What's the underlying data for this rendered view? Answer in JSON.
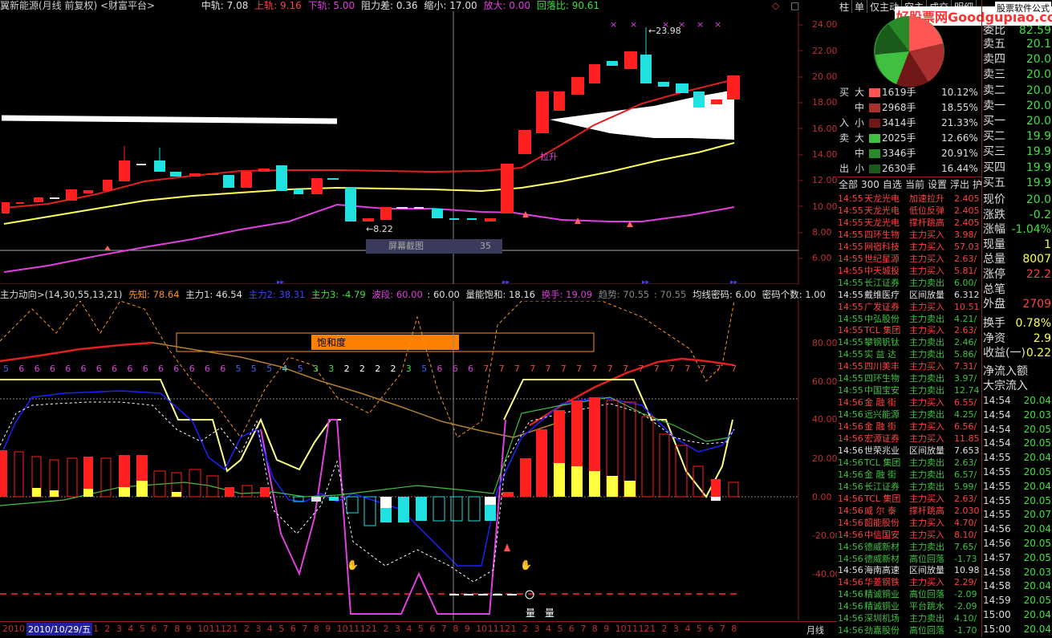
{
  "main_header": {
    "title": "翼新能源(月线 前复权) <财富平台>",
    "mid_label": "中轨: 7.08",
    "up_label": "上轨: 9.16",
    "down_label": "下轨: 5.00",
    "resist_label": "阻力差: 0.36",
    "shrink_label": "缩小: 17.00",
    "enlarge_label": "放大: 0.00",
    "pullback_label": "回落比: 90.61"
  },
  "price_axis": [
    "24.00",
    "22.00",
    "20.00",
    "18.00",
    "16.00",
    "14.00",
    "12.00",
    "10.00",
    "8.00",
    "6.00"
  ],
  "annotations": {
    "high": "23.98",
    "low": "8.22",
    "screen_capture": "屏幕截图",
    "screen_capture_num": "35",
    "right_arrow_label": "拉升",
    "saturation": "饱和度"
  },
  "indicator_header": {
    "name": "主力动向>(14,30,55,13,21)",
    "xianzhi": "先知: 78.64",
    "zhuli1": "主力1: 46.54",
    "zhuli2": "主力2: 38.31",
    "zhuli3": "主力3: -4.79",
    "boduan": "波段: 60.00",
    "boduan2": ": 60.00",
    "liangneng": "量能饱和: 18.16",
    "huanshou": "换手: 19.09",
    "qushi": "趋势: 70.55",
    "qushi2": ": 70.55",
    "junxian": "均线密码: 6.00",
    "mima": "密码个数: 1.00"
  },
  "indicator_axis": [
    "80.00",
    "60.00",
    "40.00",
    "20.00",
    "0.00",
    "-20.00",
    "-40.00"
  ],
  "digit_strip": [
    "5",
    "6",
    "6",
    "6",
    "6",
    "6",
    "6",
    "6",
    "6",
    "6",
    "6",
    "6",
    "6",
    "6",
    "6",
    "5",
    "5",
    "5",
    "4",
    "5",
    "3",
    "3",
    "2",
    "2",
    "2",
    "2",
    "3",
    "5",
    "6",
    "6",
    "6",
    "7",
    "7",
    "7",
    "7",
    "7",
    "7",
    "7",
    "7",
    "7",
    "7",
    "7",
    "7",
    "7",
    "7",
    "7",
    "7",
    "7"
  ],
  "date_bar": {
    "year_stub": "2010",
    "selected_date": "2010/10/29/五",
    "numbers": [
      "1",
      "2",
      "3",
      "4",
      "5",
      "6",
      "7",
      "8",
      "9",
      "10",
      "11",
      "12",
      "1",
      "2",
      "3",
      "4",
      "5",
      "6",
      "7",
      "8",
      "9",
      "10",
      "11",
      "12",
      "1",
      "2",
      "3",
      "4",
      "5",
      "6",
      "7",
      "8",
      "9",
      "10",
      "11",
      "12",
      "1",
      "2",
      "3",
      "4",
      "5",
      "6",
      "7",
      "8",
      "9",
      "10",
      "11",
      "12",
      "1",
      "2",
      "3",
      "4",
      "5",
      "6",
      "7",
      "8"
    ],
    "period": "月线",
    "vol_labels": [
      "量",
      "量"
    ]
  },
  "right_panel": {
    "tabs_top": [
      "柱",
      "单",
      "仅主动",
      "空主",
      "成交",
      "明细"
    ],
    "watermark": "好股票网Goodgupiao.com",
    "watermark2": "股票软件公式",
    "buy_rows": [
      {
        "side": "买",
        "cls": "大",
        "vol": "1619手",
        "pct": "10.12%",
        "color": "#ff5555"
      },
      {
        "side": "",
        "cls": "中",
        "vol": "2968手",
        "pct": "18.55%",
        "color": "#aa3030"
      },
      {
        "side": "入",
        "cls": "小",
        "vol": "3414手",
        "pct": "21.33%",
        "color": "#701818"
      }
    ],
    "sell_rows": [
      {
        "side": "卖",
        "cls": "大",
        "vol": "2025手",
        "pct": "12.66%",
        "color": "#40c040"
      },
      {
        "side": "",
        "cls": "中",
        "vol": "3346手",
        "pct": "20.91%",
        "color": "#2a8a2a"
      },
      {
        "side": "出",
        "cls": "小",
        "vol": "2630手",
        "pct": "16.44%",
        "color": "#1a5a1a"
      }
    ],
    "filter_tabs": [
      "全部",
      "300",
      "自选",
      "当前",
      "设置",
      "浮出",
      "护"
    ],
    "radar": [
      {
        "t": "14:55",
        "n": "天龙光电",
        "a": "加速拉升",
        "v": "2.405",
        "c": "#ff4040"
      },
      {
        "t": "14:55",
        "n": "天龙光电",
        "a": "低位反弹",
        "v": "2.405",
        "c": "#ff4040"
      },
      {
        "t": "14:55",
        "n": "天龙光电",
        "a": "撑杆跳高",
        "v": "2.405",
        "c": "#ff4040"
      },
      {
        "t": "14:55",
        "n": "四环生物",
        "a": "主力买入",
        "v": "3.98/",
        "c": "#ff4040"
      },
      {
        "t": "14:55",
        "n": "网宿科技",
        "a": "主力买入",
        "v": "57.03",
        "c": "#ff4040"
      },
      {
        "t": "14:55",
        "n": "世纪星源",
        "a": "主力买入",
        "v": "2.63/",
        "c": "#ff4040"
      },
      {
        "t": "14:55",
        "n": "中天城投",
        "a": "主力买入",
        "v": "5.81/",
        "c": "#ff4040"
      },
      {
        "t": "14:55",
        "n": "长江证券",
        "a": "主力卖出",
        "v": "6.00/",
        "c": "#40c040"
      },
      {
        "t": "14:55",
        "n": "戴维医疗",
        "a": "区间放量",
        "v": "6.312",
        "c": "#e0e0e0"
      },
      {
        "t": "14:55",
        "n": "广发证券",
        "a": "主力买入",
        "v": "10.51",
        "c": "#ff4040"
      },
      {
        "t": "14:55",
        "n": "中弘股份",
        "a": "主力卖出",
        "v": "4.21/",
        "c": "#40c040"
      },
      {
        "t": "14:55",
        "n": "TCL 集团",
        "a": "主力买入",
        "v": "2.63/",
        "c": "#ff4040"
      },
      {
        "t": "14:55",
        "n": "攀钢钒钛",
        "a": "主力卖出",
        "v": "2.46/",
        "c": "#40c040"
      },
      {
        "t": "14:55",
        "n": "实 益 达",
        "a": "主力卖出",
        "v": "5.86/",
        "c": "#40c040"
      },
      {
        "t": "14:55",
        "n": "四川美丰",
        "a": "主力买入",
        "v": "7.31/",
        "c": "#ff4040"
      },
      {
        "t": "14:55",
        "n": "四环生物",
        "a": "主力卖出",
        "v": "3.97/",
        "c": "#40c040"
      },
      {
        "t": "14:55",
        "n": "中国宝安",
        "a": "主力卖出",
        "v": "12.74",
        "c": "#40c040"
      },
      {
        "t": "14:56",
        "n": "金 融 街",
        "a": "主力买入",
        "v": "6.55/",
        "c": "#ff4040"
      },
      {
        "t": "14:56",
        "n": "远兴能源",
        "a": "主力卖出",
        "v": "4.25/",
        "c": "#40c040"
      },
      {
        "t": "14:56",
        "n": "金 融 街",
        "a": "主力买入",
        "v": "6.56/",
        "c": "#ff4040"
      },
      {
        "t": "14:56",
        "n": "宏源证券",
        "a": "主力买入",
        "v": "11.85",
        "c": "#ff4040"
      },
      {
        "t": "14:56",
        "n": "世荣兆业",
        "a": "区间放量",
        "v": "7.653",
        "c": "#e0e0e0"
      },
      {
        "t": "14:56",
        "n": "TCL 集团",
        "a": "主力卖出",
        "v": "2.63/",
        "c": "#40c040"
      },
      {
        "t": "14:56",
        "n": "金 融 街",
        "a": "主力卖出",
        "v": "6.57/",
        "c": "#40c040"
      },
      {
        "t": "14:56",
        "n": "长江证券",
        "a": "主力卖出",
        "v": "5.99/",
        "c": "#40c040"
      },
      {
        "t": "14:56",
        "n": "TCL 集团",
        "a": "主力买入",
        "v": "2.63/",
        "c": "#ff4040"
      },
      {
        "t": "14:56",
        "n": "威 尔 泰",
        "a": "撑杆跳高",
        "v": "2.030",
        "c": "#ff4040"
      },
      {
        "t": "14:56",
        "n": "韶能股份",
        "a": "主力买入",
        "v": "4.70/",
        "c": "#ff4040"
      },
      {
        "t": "14:56",
        "n": "中信国安",
        "a": "主力买入",
        "v": "8.10/",
        "c": "#ff4040"
      },
      {
        "t": "14:56",
        "n": "德威新材",
        "a": "主力卖出",
        "v": "7.65/",
        "c": "#40c040"
      },
      {
        "t": "14:56",
        "n": "德威新材",
        "a": "高位回落",
        "v": "-1.73",
        "c": "#40c040"
      },
      {
        "t": "14:56",
        "n": "海南高速",
        "a": "区间放量",
        "v": "10.98",
        "c": "#e0e0e0"
      },
      {
        "t": "14:56",
        "n": "华菱钢铁",
        "a": "主力买入",
        "v": "2.29/",
        "c": "#ff4040"
      },
      {
        "t": "14:56",
        "n": "精诚铜业",
        "a": "高位回落",
        "v": "-2.09",
        "c": "#40c040"
      },
      {
        "t": "14:56",
        "n": "精诚铜业",
        "a": "平台跳水",
        "v": "-2.09",
        "c": "#40c040"
      },
      {
        "t": "14:56",
        "n": "深圳机场",
        "a": "主力卖出",
        "v": "4.10/",
        "c": "#40c040"
      },
      {
        "t": "14:56",
        "n": "劲嘉股份",
        "a": "高位回落",
        "v": "-1.70",
        "c": "#40c040"
      }
    ],
    "order_book": {
      "top_label": "委比",
      "top_val": "82.59",
      "sells": [
        {
          "l": "卖五",
          "v": "20.1"
        },
        {
          "l": "卖四",
          "v": "20.0"
        },
        {
          "l": "卖三",
          "v": "20.0"
        },
        {
          "l": "卖二",
          "v": "20.0"
        },
        {
          "l": "卖一",
          "v": "20.0"
        }
      ],
      "buys": [
        {
          "l": "买一",
          "v": "20.0"
        },
        {
          "l": "买二",
          "v": "19.9"
        },
        {
          "l": "买三",
          "v": "19.9"
        },
        {
          "l": "买四",
          "v": "19.9"
        },
        {
          "l": "买五",
          "v": "19.9"
        }
      ],
      "quotes": [
        {
          "l": "现价",
          "v": "20.0",
          "c": "#40e040"
        },
        {
          "l": "涨跌",
          "v": "-0.2",
          "c": "#40e040"
        },
        {
          "l": "涨幅",
          "v": "-1.04%",
          "c": "#40e040"
        },
        {
          "l": "现量",
          "v": "1",
          "c": "#ffff40"
        },
        {
          "l": "总量",
          "v": "8007",
          "c": "#ffff40"
        },
        {
          "l": "涨停",
          "v": "22.2",
          "c": "#ff4040"
        },
        {
          "l": "总笔",
          "v": "",
          "c": "#ffff40"
        },
        {
          "l": "外盘",
          "v": "2709",
          "c": "#ff4040"
        }
      ],
      "extras": [
        {
          "l": "换手",
          "v": "0.78%",
          "c": "#ffff40"
        },
        {
          "l": "净资",
          "v": "2.9",
          "c": "#ffff40"
        },
        {
          "l": "收益(一)",
          "v": "0.22",
          "c": "#ffff40"
        }
      ],
      "flow": [
        "净流入额",
        "大宗流入"
      ],
      "ticks": [
        {
          "t": "14:54",
          "v": "20.04"
        },
        {
          "t": "14:54",
          "v": "20.03"
        },
        {
          "t": "14:54",
          "v": "20.05"
        },
        {
          "t": "14:54",
          "v": "20.05"
        },
        {
          "t": "14:55",
          "v": "20.04"
        },
        {
          "t": "14:55",
          "v": "20.05"
        },
        {
          "t": "14:55",
          "v": "20.04"
        },
        {
          "t": "14:55",
          "v": "20.05"
        },
        {
          "t": "14:55",
          "v": "20.07"
        },
        {
          "t": "14:56",
          "v": "20.04"
        },
        {
          "t": "14:56",
          "v": "20.05"
        },
        {
          "t": "14:57",
          "v": "20.05"
        },
        {
          "t": "14:58",
          "v": "20.03"
        },
        {
          "t": "14:58",
          "v": "20.04"
        },
        {
          "t": "14:59",
          "v": "20.05"
        },
        {
          "t": "15:00",
          "v": "20.04"
        },
        {
          "t": "15:00",
          "v": "20.04"
        }
      ]
    }
  }
}
